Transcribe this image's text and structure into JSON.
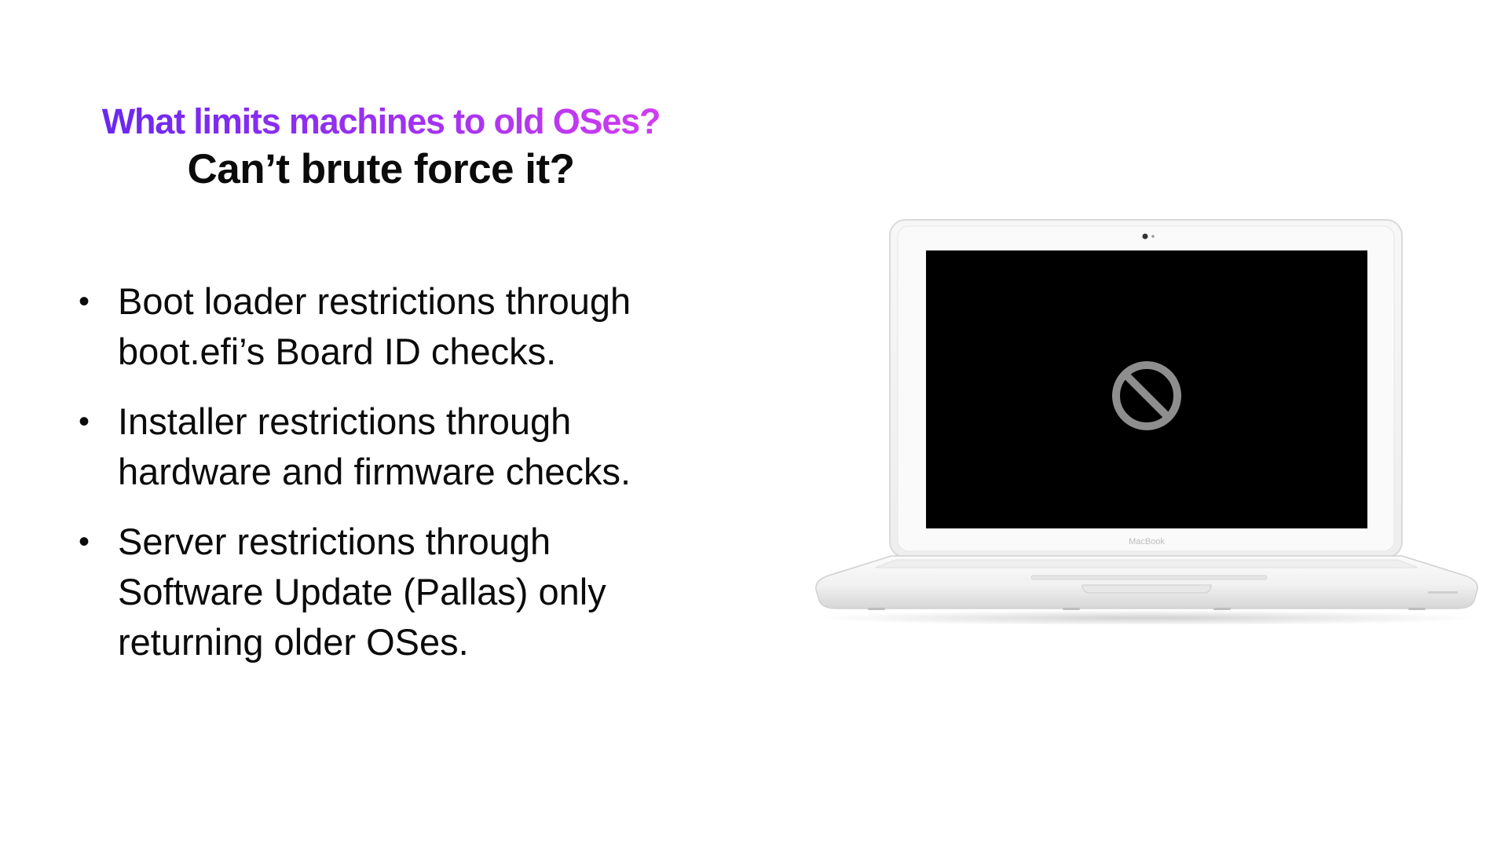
{
  "slide": {
    "title": "What limits machines to old OSes?",
    "subtitle": "Can’t brute force it?",
    "bullets": [
      {
        "marker": "•",
        "text": "Boot loader restrictions through boot.efi’s Board ID checks."
      },
      {
        "marker": "•",
        "text": "Installer restrictions through hardware and firmware checks."
      },
      {
        "marker": "•",
        "text": "Server restrictions through Software Update (Pallas) only returning older OSes."
      }
    ],
    "illustration": {
      "device_label": "MacBook",
      "screen_icon": "prohibited-icon"
    }
  },
  "colors": {
    "title_gradient_start": "#6a28f0",
    "title_gradient_end": "#d03cf0",
    "text": "#0b0b0b",
    "background": "#ffffff",
    "screen": "#000000",
    "prohibited_icon": "#8e8e8e"
  }
}
